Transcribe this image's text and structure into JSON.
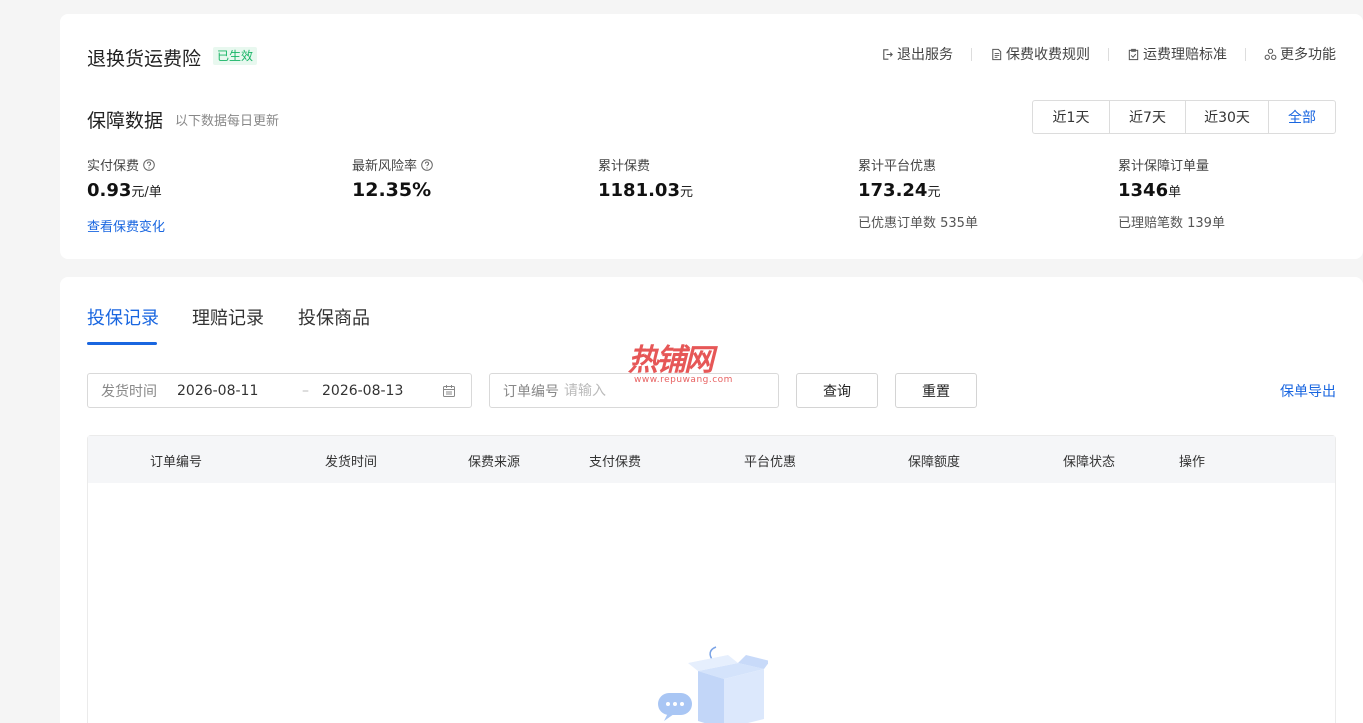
{
  "header": {
    "title": "退换货运费险",
    "status": "已生效",
    "actions": [
      {
        "label": "退出服务",
        "icon": "exit-icon"
      },
      {
        "label": "保费收费规则",
        "icon": "document-icon"
      },
      {
        "label": "运费理赔标准",
        "icon": "clipboard-icon"
      },
      {
        "label": "更多功能",
        "icon": "apps-icon"
      }
    ]
  },
  "stats": {
    "title": "保障数据",
    "subtitle": "以下数据每日更新",
    "ranges": [
      "近1天",
      "近7天",
      "近30天",
      "全部"
    ],
    "selected_range": "全部",
    "metrics": [
      {
        "label": "实付保费",
        "value": "0.93",
        "unit": "元/单",
        "link": "查看保费变化"
      },
      {
        "label": "最新风险率",
        "value": "12.35%",
        "unit": ""
      },
      {
        "label": "累计保费",
        "value": "1181.03",
        "unit": "元"
      },
      {
        "label": "累计平台优惠",
        "value": "173.24",
        "unit": "元",
        "sub": "已优惠订单数 535单"
      },
      {
        "label": "累计保障订单量",
        "value": "1346",
        "unit": "单",
        "sub": "已理赔笔数 139单"
      }
    ]
  },
  "tabs": [
    "投保记录",
    "理赔记录",
    "投保商品"
  ],
  "active_tab": "投保记录",
  "filters": {
    "date_label": "发货时间",
    "date_start": "2026-08-11",
    "date_end": "2026-08-13",
    "date_separator": "–",
    "order_label": "订单编号",
    "order_placeholder": "请输入",
    "query": "查询",
    "reset": "重置",
    "export": "保单导出"
  },
  "table": {
    "columns": [
      "订单编号",
      "发货时间",
      "保费来源",
      "支付保费",
      "平台优惠",
      "保障额度",
      "保障状态",
      "操作"
    ]
  },
  "watermark": {
    "text": "热铺网",
    "url": "www.repuwang.com"
  },
  "colors": {
    "accent": "#1966e0",
    "status_green": "#18b566",
    "watermark_red": "#e23a3a"
  }
}
